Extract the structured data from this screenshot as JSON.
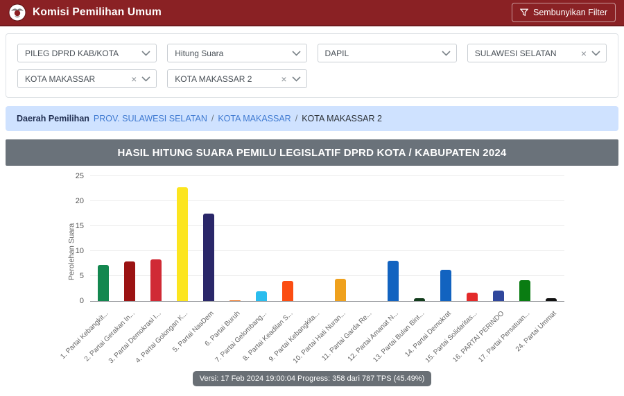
{
  "header": {
    "app_title": "Komisi Pemilihan Umum",
    "filter_toggle_label": "Sembunyikan Filter"
  },
  "filters": {
    "items": [
      {
        "value": "PILEG DPRD KAB/KOTA",
        "clearable": false
      },
      {
        "value": "Hitung Suara",
        "clearable": false
      },
      {
        "value": "DAPIL",
        "clearable": false
      },
      {
        "value": "SULAWESI SELATAN",
        "clearable": true
      },
      {
        "value": "KOTA MAKASSAR",
        "clearable": true
      },
      {
        "value": "KOTA MAKASSAR 2",
        "clearable": true
      }
    ]
  },
  "breadcrumb": {
    "label": "Daerah Pemilihan",
    "link1": "PROV. SULAWESI SELATAN",
    "link2": "KOTA MAKASSAR",
    "current": "KOTA MAKASSAR 2",
    "separator": "/"
  },
  "chart_title": "HASIL HITUNG SUARA PEMILU LEGISLATIF DPRD KOTA / KABUPATEN 2024",
  "chart_data": {
    "type": "bar",
    "title": "HASIL HITUNG SUARA PEMILU LEGISLATIF DPRD KOTA / KABUPATEN 2024",
    "xlabel": "",
    "ylabel": "Perolehan Suara",
    "ylim": [
      0,
      25
    ],
    "yticks": [
      0,
      5,
      10,
      15,
      20,
      25
    ],
    "grid": true,
    "legend": false,
    "categories": [
      "1. Partai Kebangkit...",
      "2. Partai Gerakan In...",
      "3. Partai Demokrasi I...",
      "4. Partai Golongan K...",
      "5. Partai NasDem",
      "6. Partai Buruh",
      "7. Partai Gelombang...",
      "8. Partai Keadilan S...",
      "9. Partai Kebangkita...",
      "10. Partai Hati Nuran...",
      "11. Partai Garda Re...",
      "12. Partai Amanat N...",
      "13. Partai Bulan Bint...",
      "14. Partai Demokrat",
      "15. Partai Solidaritas...",
      "16. PARTAI PERINDO",
      "17. Partai Persatuan...",
      "24. Partai Ummat"
    ],
    "values": [
      7.2,
      7.9,
      8.3,
      22.8,
      17.5,
      0.2,
      2.0,
      4.0,
      0,
      4.4,
      0,
      8.1,
      0.6,
      6.2,
      1.7,
      2.1,
      4.1,
      0.5
    ],
    "colors": [
      "#13874f",
      "#9b1313",
      "#d02a35",
      "#fce51f",
      "#2a2769",
      "#ee7d31",
      "#2abdee",
      "#fb4d12",
      "#999999",
      "#efa11d",
      "#999999",
      "#1263c0",
      "#123c1c",
      "#1263c0",
      "#e32a2a",
      "#30479c",
      "#0a7c12",
      "#111111"
    ]
  },
  "footer": {
    "status": "Versi: 17 Feb 2024 19:00:04 Progress: 358 dari 787 TPS (45.49%)"
  },
  "colors": {
    "header_bg": "#8a2124",
    "breadcrumb_bg": "#cfe2ff",
    "title_bg": "#6a727a",
    "link_blue": "#3f7ad1"
  }
}
